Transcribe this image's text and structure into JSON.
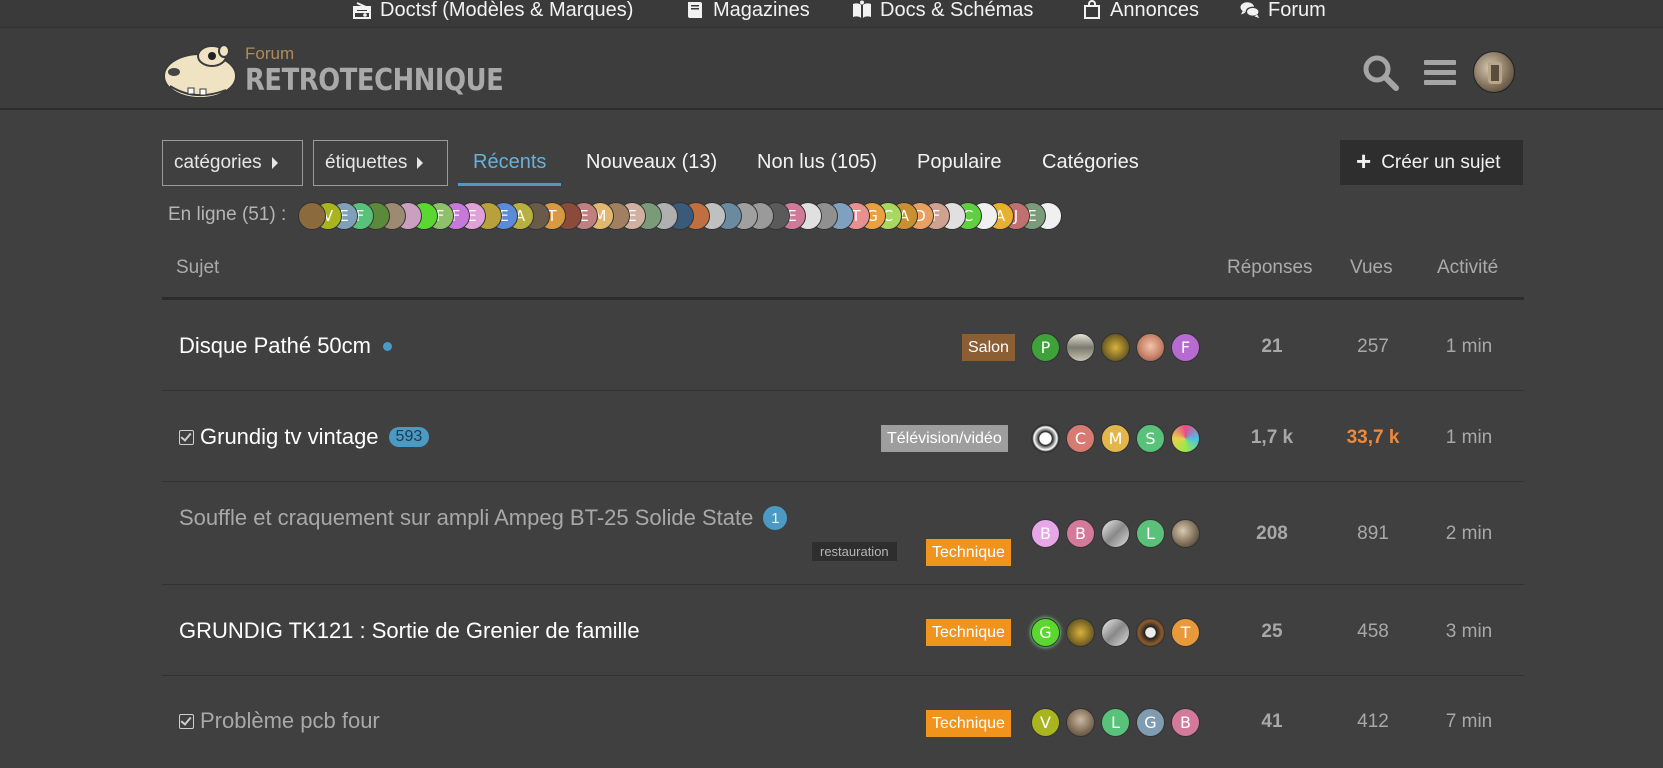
{
  "topnav": [
    {
      "label": "Doctsf (Modèles & Marques)",
      "icon": "radio-icon"
    },
    {
      "label": "Magazines",
      "icon": "book-icon"
    },
    {
      "label": "Docs & Schémas",
      "icon": "open-book-icon"
    },
    {
      "label": "Annonces",
      "icon": "shopping-bag-icon"
    },
    {
      "label": "Forum",
      "icon": "comments-icon"
    }
  ],
  "header": {
    "logo_small": "Forum",
    "logo_big": "RETROTECHNIQUE"
  },
  "filters": {
    "categories": "catégories",
    "tags": "étiquettes"
  },
  "tabs": [
    "Récents",
    "Nouveaux (13)",
    "Non lus (105)",
    "Populaire",
    "Catégories"
  ],
  "create_label": "Créer un sujet",
  "online": {
    "label": "En ligne (51) :",
    "letters": [
      "",
      "V",
      "E",
      "F",
      "",
      "",
      "",
      "",
      "F",
      "F",
      "E",
      "",
      "E",
      "A",
      "",
      "T",
      "",
      "E",
      "M",
      "",
      "E",
      "",
      "",
      "",
      "",
      "",
      "",
      "",
      "",
      "",
      "E",
      "",
      "",
      "",
      "T",
      "G",
      "C",
      "A",
      "D",
      "F",
      "",
      "C",
      "",
      "A",
      "J",
      "E",
      ""
    ]
  },
  "columns": {
    "topic": "Sujet",
    "replies": "Réponses",
    "views": "Vues",
    "activity": "Activité"
  },
  "topics": [
    {
      "title": "Disque Pathé 50cm",
      "category": "Salon",
      "category_color": "#8b5e34",
      "replies": "21",
      "views": "257",
      "activity": "1 min",
      "posters": [
        "P",
        "",
        "",
        "",
        "F"
      ]
    },
    {
      "title": "Grundig tv vintage",
      "badge": "593",
      "category": "Télévision/vidéo",
      "category_color": "#9e9e9e",
      "replies": "1,7 k",
      "views": "33,7 k",
      "activity": "1 min",
      "posters": [
        "",
        "C",
        "M",
        "S",
        ""
      ]
    },
    {
      "title": "Souffle et craquement sur ampli Ampeg BT-25 Solide State",
      "badge": "1",
      "tag": "restauration",
      "category": "Technique",
      "category_color": "#f0941e",
      "replies": "208",
      "views": "891",
      "activity": "2 min",
      "posters": [
        "B",
        "B",
        "",
        "L",
        ""
      ]
    },
    {
      "title": "GRUNDIG TK121 : Sortie de Grenier de famille",
      "category": "Technique",
      "category_color": "#f0941e",
      "replies": "25",
      "views": "458",
      "activity": "3 min",
      "posters": [
        "G",
        "",
        "",
        "",
        "T"
      ]
    },
    {
      "title": "Problème pcb four",
      "category": "Technique",
      "category_color": "#f0941e",
      "replies": "41",
      "views": "412",
      "activity": "7 min",
      "posters": [
        "V",
        "",
        "L",
        "G",
        "B"
      ]
    }
  ]
}
